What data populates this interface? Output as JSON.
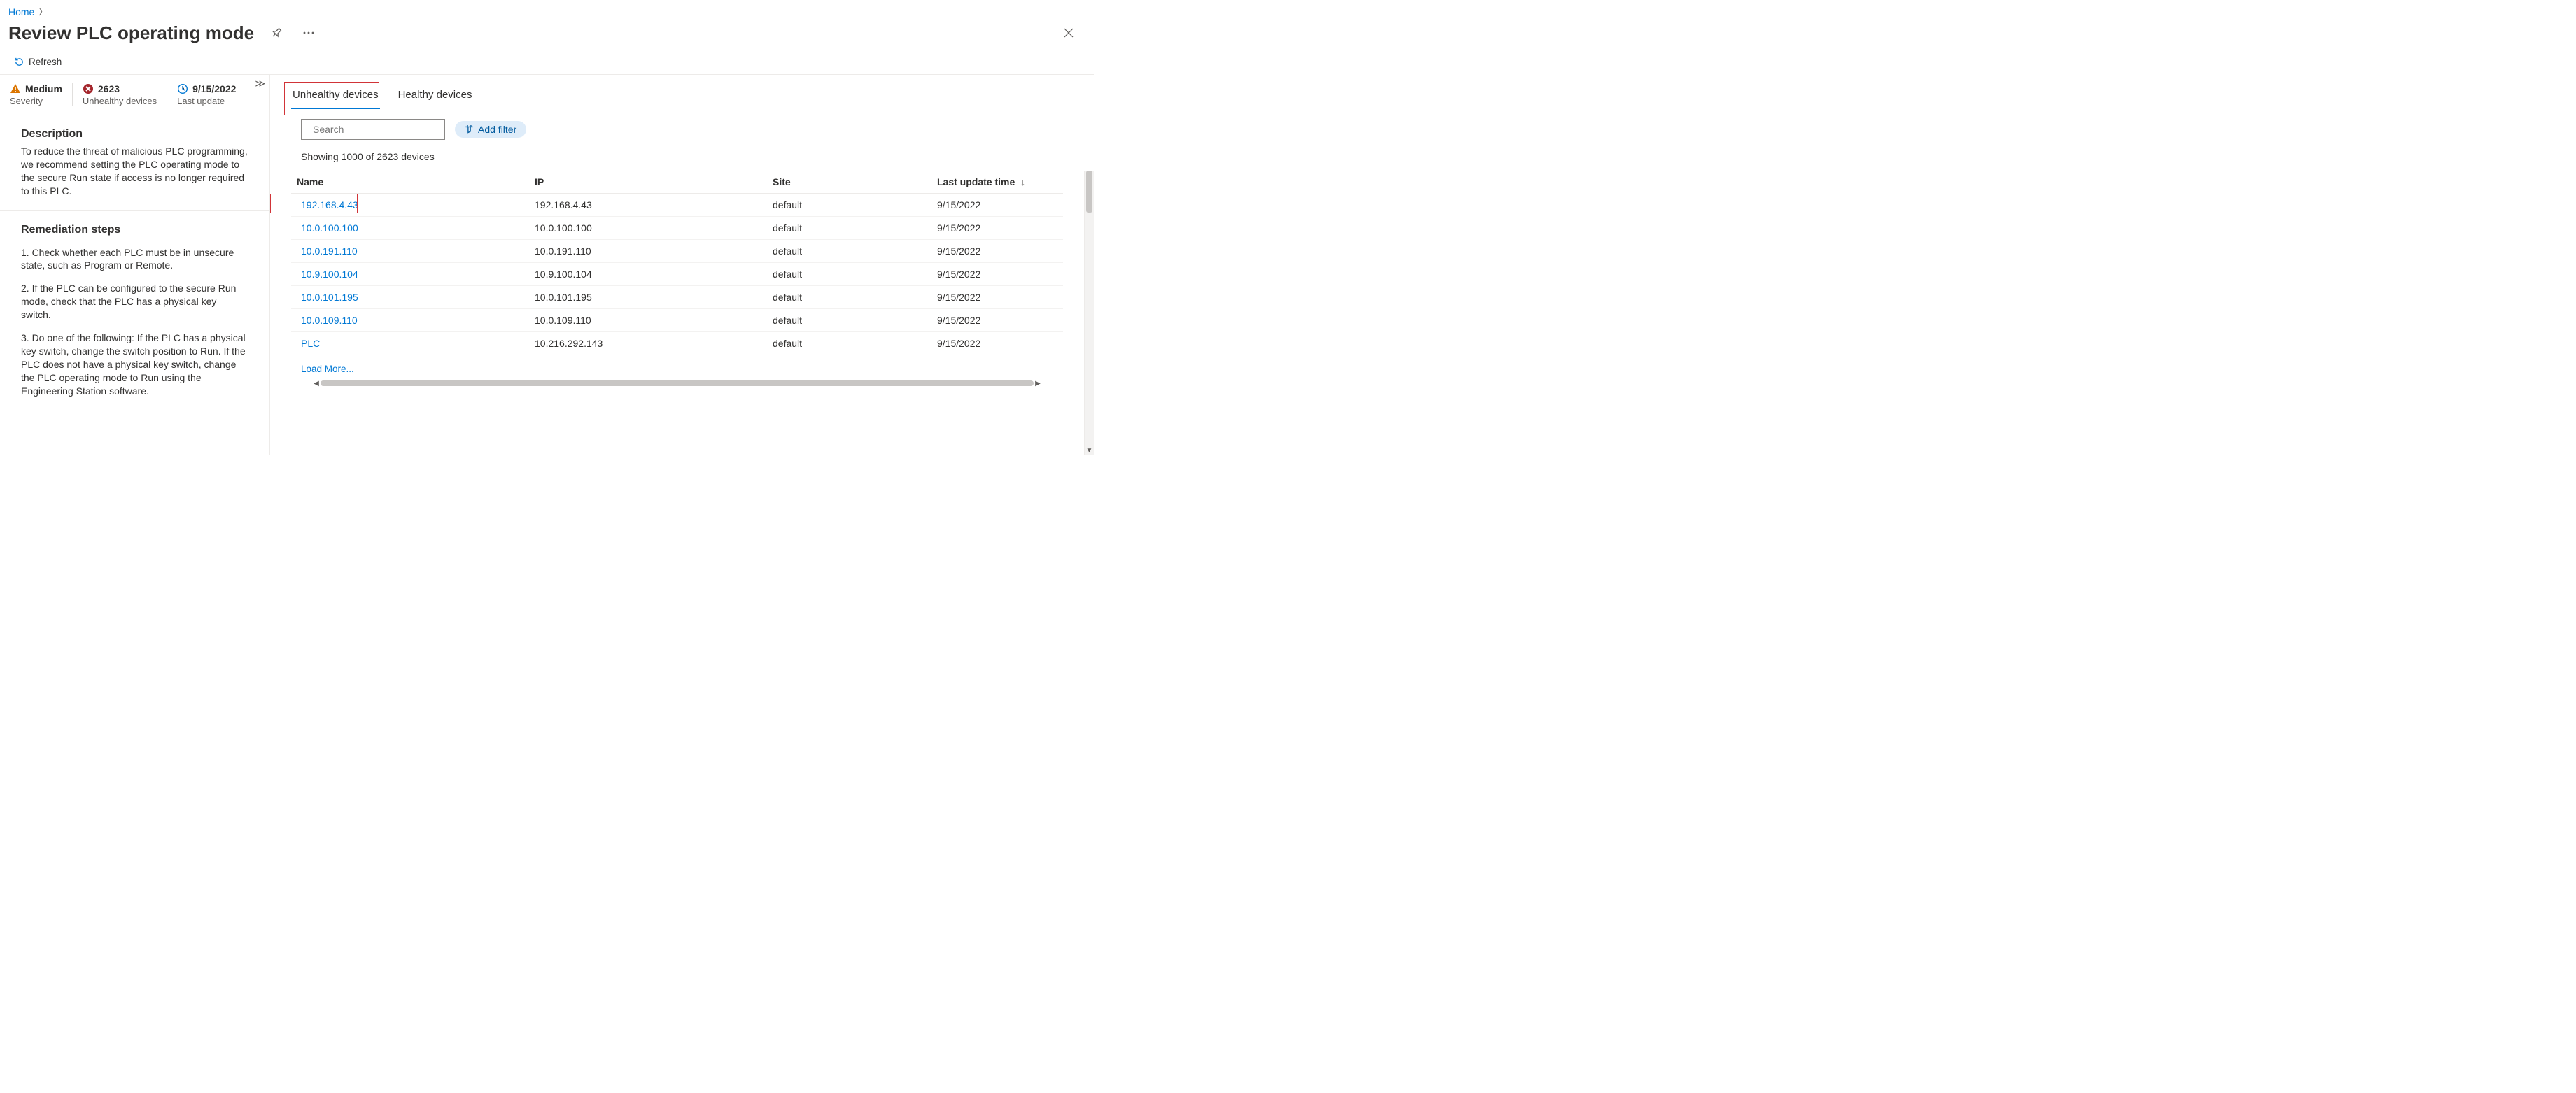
{
  "breadcrumb": {
    "home": "Home"
  },
  "page_title": "Review PLC operating mode",
  "commands": {
    "refresh": "Refresh"
  },
  "summary": {
    "severity": {
      "value": "Medium",
      "label": "Severity"
    },
    "unhealthy": {
      "value": "2623",
      "label": "Unhealthy devices"
    },
    "last_update": {
      "value": "9/15/2022",
      "label": "Last update"
    }
  },
  "description": {
    "heading": "Description",
    "body": "To reduce the threat of malicious PLC programming, we recommend setting the PLC operating mode to the secure Run state if access is no longer required to this PLC."
  },
  "remediation": {
    "heading": "Remediation steps",
    "steps": [
      "1. Check whether each PLC must be in unsecure state, such as Program or Remote.",
      "2. If the PLC can be configured to the secure Run mode, check that the PLC has a physical key switch.",
      "3. Do one of the following: If the PLC has a physical key switch, change the switch position to Run. If the PLC does not have a physical key switch, change the PLC operating mode to Run using the Engineering Station software."
    ]
  },
  "tabs": {
    "unhealthy": "Unhealthy devices",
    "healthy": "Healthy devices"
  },
  "filter": {
    "search_placeholder": "Search",
    "add_filter": "Add filter"
  },
  "showing": "Showing 1000 of 2623 devices",
  "columns": {
    "name": "Name",
    "ip": "IP",
    "site": "Site",
    "last_update": "Last update time"
  },
  "rows": [
    {
      "name": "192.168.4.43",
      "ip": "192.168.4.43",
      "site": "default",
      "time": "9/15/2022"
    },
    {
      "name": "10.0.100.100",
      "ip": "10.0.100.100",
      "site": "default",
      "time": "9/15/2022"
    },
    {
      "name": "10.0.191.110",
      "ip": "10.0.191.110",
      "site": "default",
      "time": "9/15/2022"
    },
    {
      "name": "10.9.100.104",
      "ip": "10.9.100.104",
      "site": "default",
      "time": "9/15/2022"
    },
    {
      "name": "10.0.101.195",
      "ip": "10.0.101.195",
      "site": "default",
      "time": "9/15/2022"
    },
    {
      "name": "10.0.109.110",
      "ip": "10.0.109.110",
      "site": "default",
      "time": "9/15/2022"
    },
    {
      "name": "PLC",
      "ip": "10.216.292.143",
      "site": "default",
      "time": "9/15/2022"
    }
  ],
  "load_more": "Load More...",
  "colors": {
    "link": "#0078d4",
    "warning": "#f2a100",
    "error": "#a4262c",
    "highlight": "#d13438"
  }
}
